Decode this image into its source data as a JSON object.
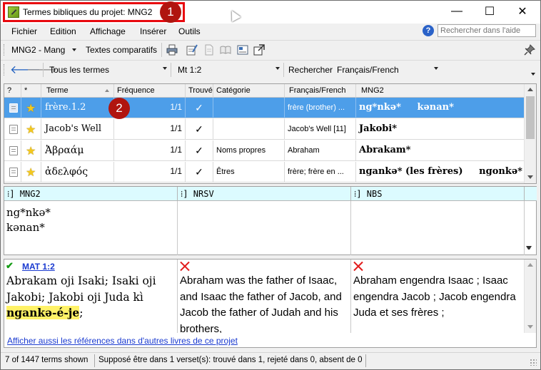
{
  "window": {
    "title": "Termes bibliques du projet: MNG2",
    "minimize_glyph": "—",
    "maximize_glyph": "☐",
    "close_glyph": "✕"
  },
  "callouts": [
    "1",
    "2"
  ],
  "menu": {
    "items": [
      "Fichier",
      "Edition",
      "Affichage",
      "Insérer",
      "Outils"
    ],
    "help_search_placeholder": "Rechercher dans l'aide",
    "help_icon": "?"
  },
  "toolbar1": {
    "project": "MNG2 - Mang",
    "comparative_texts": "Textes comparatifs",
    "icons": [
      "print-icon",
      "edit-note-icon",
      "document-icon",
      "book-icon",
      "text-box-icon",
      "open-external-icon",
      "pin-icon"
    ]
  },
  "toolbar2": {
    "back_glyph": "🡐",
    "forward_glyph": "🡒",
    "filter": "Tous les termes",
    "reference": "Mt 1:2",
    "search_label": "Rechercher",
    "search_language": "Français/French"
  },
  "grid": {
    "headers": [
      "?",
      "*",
      "Terme",
      "Fréquence",
      "Trouvé",
      "Catégorie",
      "Français/French",
      "MNG2"
    ],
    "rows": [
      {
        "term": "frère.1.2",
        "freq": "1/1",
        "found": "✓",
        "category": "",
        "gloss": "frère (brother) ...",
        "rendering": "ng*nkə*     kənan*",
        "selected": true
      },
      {
        "term": "Jacob's Well",
        "freq": "1/1",
        "found": "✓",
        "category": "",
        "gloss": "Jacob's Well [11]",
        "rendering": "Jakobi*",
        "selected": false
      },
      {
        "term": "Ἀβραάμ",
        "freq": "1/1",
        "found": "✓",
        "category": "Noms propres",
        "gloss": "Abraham",
        "rendering": "Abrakam*",
        "selected": false
      },
      {
        "term": "ἀδελφός",
        "freq": "1/1",
        "found": "✓",
        "category": "Êtres",
        "gloss": "frère; frère en ...",
        "rendering": "ngankə* (les frères)     ngonkə* ...",
        "selected": false
      }
    ]
  },
  "renderings": {
    "headers": [
      "MNG2",
      "NRSV",
      "NBS"
    ],
    "header_glyph": "⁞]",
    "lines": [
      "ng*nkə*",
      "kənan*"
    ]
  },
  "verses": {
    "reference": "MAT 1:2",
    "mng2_before": "Abrakam oji Isaki; Isaki oji Jakobi; Jakobi oji Juda kì ",
    "mng2_highlight": "ngankə-é-je",
    "mng2_after": ";",
    "nrsv": "Abraham was the father of Isaac, and Isaac the father of Jacob, and Jacob the father of Judah and his brothers,",
    "nbs": "Abraham engendra Isaac ; Isaac engendra Jacob ; Jacob engendra Juda et ses frères ;",
    "show_link": "Afficher aussi les références dans d'autres livres de ce projet"
  },
  "status": {
    "terms_shown": "7 of 1447 terms shown",
    "summary": "Supposé être dans 1 verset(s):  trouvé dans 1, rejeté dans 0, absent de 0"
  },
  "colors": {
    "selection": "#4d9ee9",
    "callout_red": "#e8090f",
    "callout_fill": "#b0150f",
    "rendering_header": "#dcfbff",
    "highlight": "#fff267",
    "link": "#1a3ad0"
  }
}
